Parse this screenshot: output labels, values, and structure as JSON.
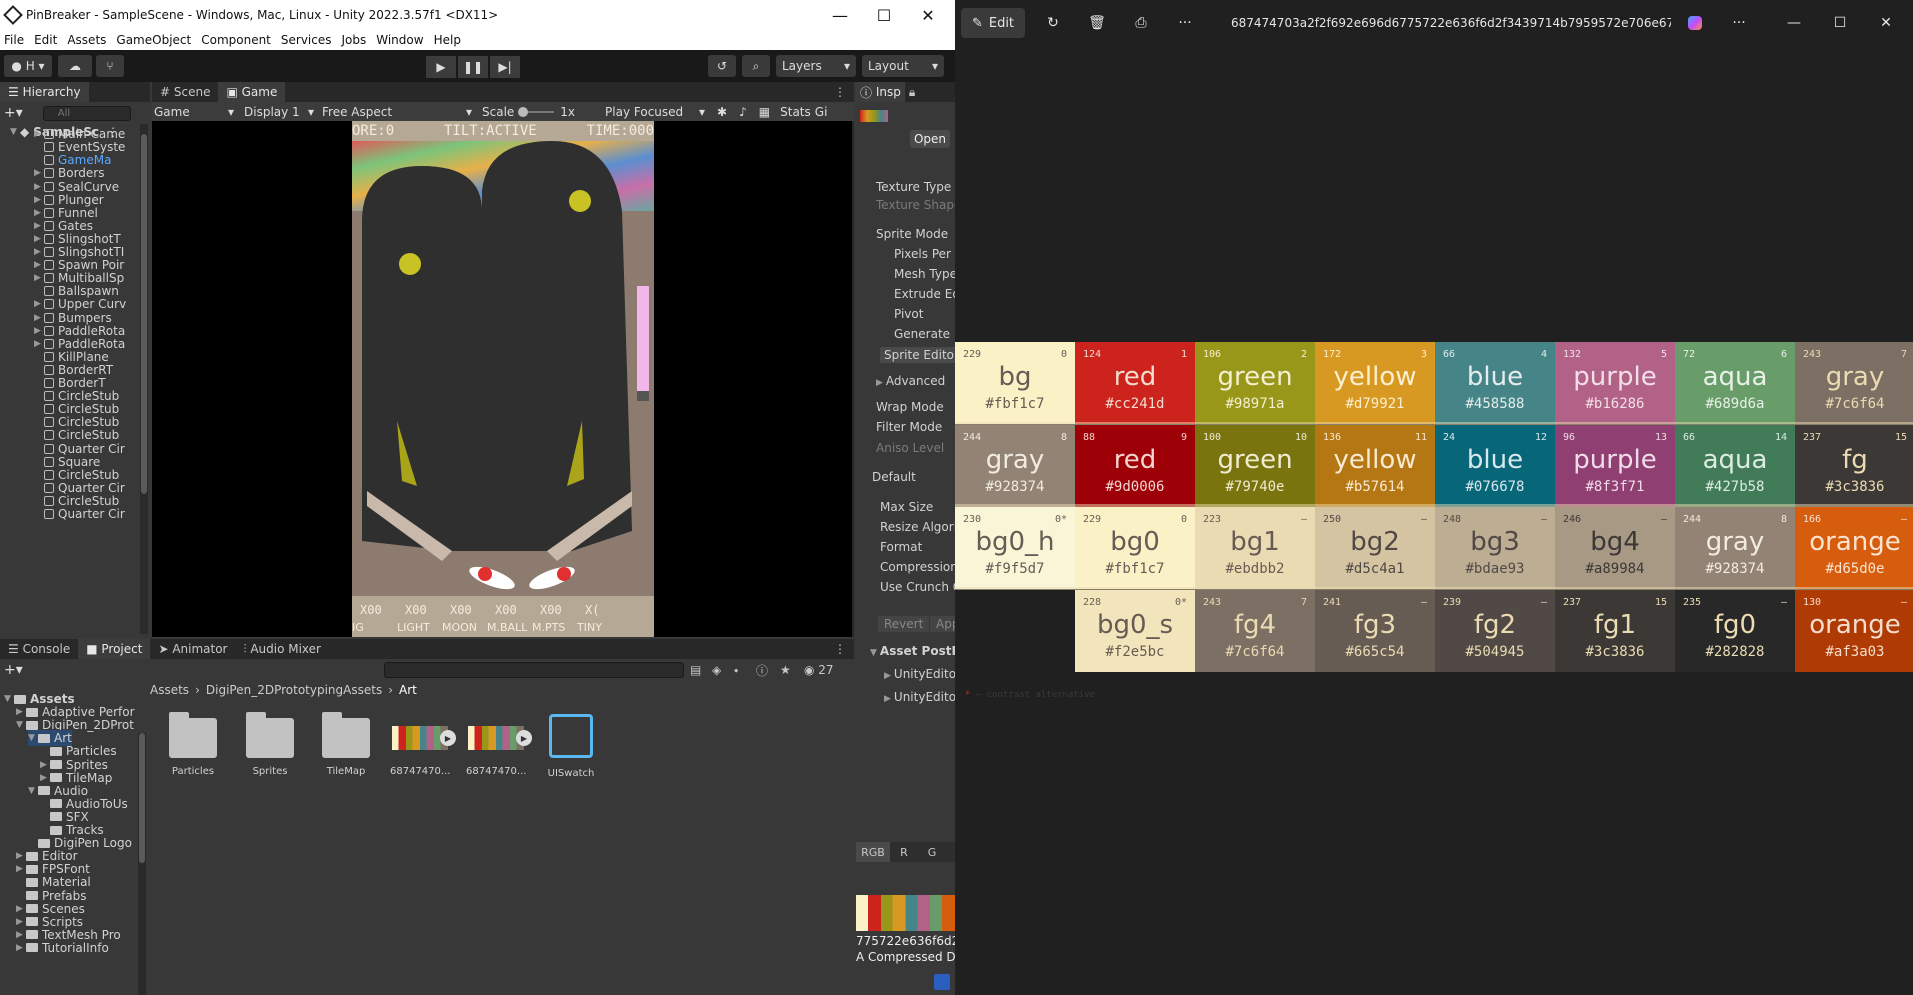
{
  "unity": {
    "title": "PinBreaker - SampleScene - Windows, Mac, Linux - Unity 2022.3.57f1 <DX11>",
    "window_controls": [
      "—",
      "☐",
      "✕"
    ],
    "menu": [
      "File",
      "Edit",
      "Assets",
      "GameObject",
      "Component",
      "Services",
      "Jobs",
      "Window",
      "Help"
    ],
    "toolbar": {
      "account_label": "H",
      "layers_label": "Layers",
      "layout_label": "Layout"
    },
    "hierarchy": {
      "tab_label": "Hierarchy",
      "search_placeholder": "All",
      "scene": "SampleSc",
      "items": [
        "Main Came",
        "EventSyste",
        "GameMa",
        "Borders",
        "SealCurve",
        "Plunger",
        "Funnel",
        "Gates",
        "SlingshotT",
        "SlingshotTI",
        "Spawn Poir",
        "MultiballSp",
        "Ballspawn",
        "Upper Curv",
        "Bumpers",
        "PaddleRota",
        "PaddleRota",
        "KillPlane",
        "BorderRT",
        "BorderT",
        "CircleStub",
        "CircleStub",
        "CircleStub",
        "CircleStub",
        "Quarter Cir",
        "Square",
        "CircleStub",
        "Quarter Cir",
        "CircleStub",
        "Quarter Cir"
      ]
    },
    "scene_tabs": [
      "Scene",
      "Game"
    ],
    "game_bar": {
      "mode": "Game",
      "display": "Display 1",
      "aspect": "Free Aspect",
      "scale_label": "Scale",
      "scale_value": "1x",
      "play_focused": "Play Focused",
      "stats": "Stats",
      "gizmos": "Gi"
    },
    "game_hud": {
      "score": "ORE:0",
      "tilt": "TILT:ACTIVE",
      "time": "TIME:000"
    },
    "game_bottom": {
      "values": [
        "X00",
        "X00",
        "X00",
        "X00",
        "X00",
        "X("
      ],
      "labels": [
        "IG",
        "LIGHT",
        "MOON",
        "M.BALL",
        "M.PTS",
        "TINY"
      ]
    },
    "bottom_tabs": [
      "Console",
      "Project",
      "Animator",
      "Audio Mixer"
    ],
    "project": {
      "hidden_count": "27",
      "tree": [
        "Assets",
        "Adaptive Perfor",
        "DigiPen_2DProt",
        "Art",
        "Particles",
        "Sprites",
        "TileMap",
        "Audio",
        "AudioToUs",
        "SFX",
        "Tracks",
        "DigiPen Logo",
        "Editor",
        "FPSFont",
        "Material",
        "Prefabs",
        "Scenes",
        "Scripts",
        "TextMesh Pro",
        "TutorialInfo"
      ],
      "breadcrumb": [
        "Assets",
        "DigiPen_2DPrototypingAssets",
        "Art"
      ],
      "assets": [
        "Particles",
        "Sprites",
        "TileMap",
        "68747470...",
        "68747470...",
        "UISwatch"
      ]
    },
    "inspector": {
      "tab_label": "Insp",
      "open_button": "Open",
      "rows": [
        "Texture Type",
        "Texture Shape",
        "Sprite Mode",
        "Pixels Per U",
        "Mesh Type",
        "Extrude Edg",
        "Pivot",
        "Generate P",
        "Sprite Editor",
        "Advanced",
        "Wrap Mode",
        "Filter Mode",
        "Aniso Level",
        "Default",
        "Max Size",
        "Resize Algori",
        "Format",
        "Compression",
        "Use Crunch C",
        "Revert",
        "App",
        "Asset PostPr",
        "UnityEdito",
        "UnityEdito"
      ],
      "channels": [
        "RGB",
        "R",
        "G"
      ],
      "preview_name": "775722e636f6d2",
      "preview_info": "A Compressed D"
    }
  },
  "photos": {
    "edit_label": "Edit",
    "filename": "687474703a2f2f692e696d6775722e636f6d2f3439714b7959572e706e67.png",
    "window_controls": [
      "—",
      "☐",
      "✕"
    ],
    "legend_note": "— contrast alternative",
    "palette": [
      [
        {
          "name": "bg",
          "hex": "#fbf1c7",
          "left": "229",
          "right": "0",
          "color": "#fbf1c7",
          "text": "#665c54"
        },
        {
          "name": "red",
          "hex": "#cc241d",
          "left": "124",
          "right": "1",
          "color": "#cc241d",
          "text": "#f2dcd0"
        },
        {
          "name": "green",
          "hex": "#98971a",
          "left": "106",
          "right": "2",
          "color": "#98971a",
          "text": "#f4efcf"
        },
        {
          "name": "yellow",
          "hex": "#d79921",
          "left": "172",
          "right": "3",
          "color": "#d79921",
          "text": "#fbefd0"
        },
        {
          "name": "blue",
          "hex": "#458588",
          "left": "66",
          "right": "4",
          "color": "#458588",
          "text": "#e6ecec"
        },
        {
          "name": "purple",
          "hex": "#b16286",
          "left": "132",
          "right": "5",
          "color": "#b16286",
          "text": "#f3dfe8"
        },
        {
          "name": "aqua",
          "hex": "#689d6a",
          "left": "72",
          "right": "6",
          "color": "#689d6a",
          "text": "#e8f0e8"
        },
        {
          "name": "gray",
          "hex": "#7c6f64",
          "left": "243",
          "right": "7",
          "color": "#7c6f64",
          "text": "#ebdbb2"
        }
      ],
      [
        {
          "name": "gray",
          "hex": "#928374",
          "left": "244",
          "right": "8",
          "color": "#928374",
          "text": "#f2ebe0"
        },
        {
          "name": "red",
          "hex": "#9d0006",
          "left": "88",
          "right": "9",
          "color": "#9d0006",
          "text": "#f2d5d0"
        },
        {
          "name": "green",
          "hex": "#79740e",
          "left": "100",
          "right": "10",
          "color": "#79740e",
          "text": "#efecd0"
        },
        {
          "name": "yellow",
          "hex": "#b57614",
          "left": "136",
          "right": "11",
          "color": "#b57614",
          "text": "#f8ead0"
        },
        {
          "name": "blue",
          "hex": "#076678",
          "left": "24",
          "right": "12",
          "color": "#076678",
          "text": "#d8e8ec"
        },
        {
          "name": "purple",
          "hex": "#8f3f71",
          "left": "96",
          "right": "13",
          "color": "#8f3f71",
          "text": "#f0dce8"
        },
        {
          "name": "aqua",
          "hex": "#427b58",
          "left": "66",
          "right": "14",
          "color": "#427b58",
          "text": "#dbece2"
        },
        {
          "name": "fg",
          "hex": "#3c3836",
          "left": "237",
          "right": "15",
          "color": "#3c3836",
          "text": "#ebdbb2"
        }
      ],
      [
        {
          "name": "bg0_h",
          "hex": "#f9f5d7",
          "left": "230",
          "right": "0*",
          "color": "#f9f5d7",
          "text": "#665c54"
        },
        {
          "name": "bg0",
          "hex": "#fbf1c7",
          "left": "229",
          "right": "0",
          "color": "#fbf1c7",
          "text": "#665c54"
        },
        {
          "name": "bg1",
          "hex": "#ebdbb2",
          "left": "223",
          "right": "—",
          "color": "#ebdbb2",
          "text": "#665c54"
        },
        {
          "name": "bg2",
          "hex": "#d5c4a1",
          "left": "250",
          "right": "—",
          "color": "#d5c4a1",
          "text": "#504945"
        },
        {
          "name": "bg3",
          "hex": "#bdae93",
          "left": "248",
          "right": "—",
          "color": "#bdae93",
          "text": "#504945"
        },
        {
          "name": "bg4",
          "hex": "#a89984",
          "left": "246",
          "right": "—",
          "color": "#a89984",
          "text": "#3c3836"
        },
        {
          "name": "gray",
          "hex": "#928374",
          "left": "244",
          "right": "8",
          "color": "#928374",
          "text": "#f2ebe0"
        },
        {
          "name": "orange",
          "hex": "#d65d0e",
          "left": "166",
          "right": "—",
          "color": "#d65d0e",
          "text": "#fbe3d0"
        }
      ],
      [
        {
          "name": "",
          "hex": "",
          "left": "",
          "right": "",
          "color": "#202020",
          "text": "#202020"
        },
        {
          "name": "bg0_s",
          "hex": "#f2e5bc",
          "left": "228",
          "right": "0*",
          "color": "#f2e5bc",
          "text": "#665c54"
        },
        {
          "name": "fg4",
          "hex": "#7c6f64",
          "left": "243",
          "right": "7",
          "color": "#7c6f64",
          "text": "#ebdbb2"
        },
        {
          "name": "fg3",
          "hex": "#665c54",
          "left": "241",
          "right": "—",
          "color": "#665c54",
          "text": "#ebdbb2"
        },
        {
          "name": "fg2",
          "hex": "#504945",
          "left": "239",
          "right": "—",
          "color": "#504945",
          "text": "#ebdbb2"
        },
        {
          "name": "fg1",
          "hex": "#3c3836",
          "left": "237",
          "right": "15",
          "color": "#3c3836",
          "text": "#ebdbb2"
        },
        {
          "name": "fg0",
          "hex": "#282828",
          "left": "235",
          "right": "—",
          "color": "#282828",
          "text": "#ebdbb2"
        },
        {
          "name": "orange",
          "hex": "#af3a03",
          "left": "130",
          "right": "—",
          "color": "#af3a03",
          "text": "#f5dccd"
        }
      ]
    ]
  }
}
